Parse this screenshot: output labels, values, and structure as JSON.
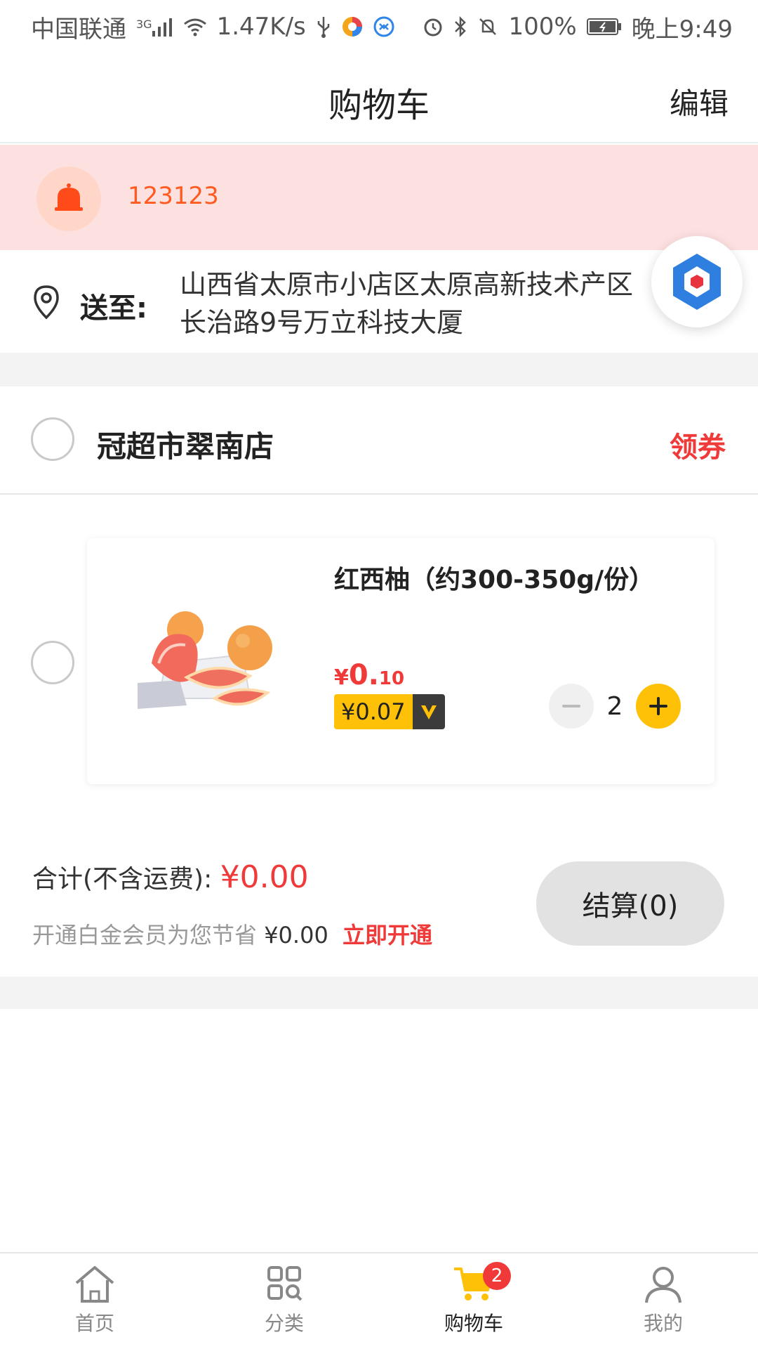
{
  "status_bar": {
    "carrier": "中国联通",
    "network": "3G",
    "speed": "1.47K/s",
    "battery": "100%",
    "time": "晚上9:49"
  },
  "header": {
    "title": "购物车",
    "edit_label": "编辑"
  },
  "notice": {
    "text": "123123",
    "icon": "bell-icon"
  },
  "address": {
    "label": "送至:",
    "text": "山西省太原市小店区太原高新技术产区长治路9号万立科技大厦"
  },
  "store": {
    "name": "冠超市翠南店",
    "coupon_label": "领券"
  },
  "item": {
    "name": "红西柚（约300-350g/份）",
    "price_symbol": "¥",
    "price_int": "0.",
    "price_dec": "10",
    "vip_price": "¥0.07",
    "vip_badge": "V",
    "quantity": "2"
  },
  "summary": {
    "total_label": "合计(不含运费):",
    "total_amount": "¥0.00",
    "vip_text": "开通白金会员为您节省",
    "vip_amount": "¥0.00",
    "vip_open": "立即开通",
    "checkout_label": "结算(0)"
  },
  "tabs": [
    {
      "label": "首页",
      "icon": "home-icon"
    },
    {
      "label": "分类",
      "icon": "category-icon"
    },
    {
      "label": "购物车",
      "icon": "cart-icon",
      "badge": "2",
      "active": true
    },
    {
      "label": "我的",
      "icon": "profile-icon"
    }
  ],
  "colors": {
    "accent": "#ffc107",
    "price_red": "#f03a3a",
    "notice_bg": "#fde1e1",
    "notice_text": "#ff5a1f"
  }
}
